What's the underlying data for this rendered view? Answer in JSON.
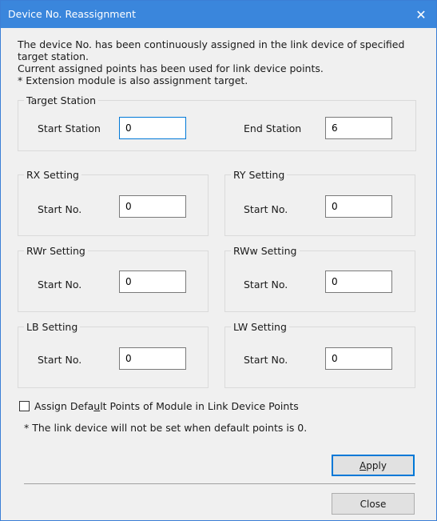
{
  "window": {
    "title": "Device No. Reassignment",
    "close_glyph": "✕"
  },
  "description": {
    "line1": "The device No. has been continuously assigned in the link device of specified",
    "line2": "target station.",
    "line3": "Current assigned points has been used for link device points.",
    "line4": "* Extension module is also assignment target."
  },
  "target_station": {
    "legend": "Target Station",
    "start_label": "Start Station",
    "start_value": "0",
    "end_label": "End Station",
    "end_value": "6"
  },
  "rx": {
    "legend": "RX Setting",
    "start_label": "Start No.",
    "start_value": "0"
  },
  "ry": {
    "legend": "RY Setting",
    "start_label": "Start No.",
    "start_value": "0"
  },
  "rwr": {
    "legend": "RWr Setting",
    "start_label": "Start No.",
    "start_value": "0"
  },
  "rww": {
    "legend": "RWw Setting",
    "start_label": "Start No.",
    "start_value": "0"
  },
  "lb": {
    "legend": "LB Setting",
    "start_label": "Start No.",
    "start_value": "0"
  },
  "lw": {
    "legend": "LW Setting",
    "start_label": "Start No.",
    "start_value": "0"
  },
  "options": {
    "assign_default_label_pre": "Assign Defa",
    "assign_default_label_mnemonic": "u",
    "assign_default_label_post": "lt Points of Module in Link Device Points",
    "assign_default_checked": false,
    "note": "* The link device will not be set when default points is 0."
  },
  "buttons": {
    "apply_mnemonic": "A",
    "apply_rest": "pply",
    "close": "Close"
  },
  "colors": {
    "title_bar": "#3a86dc",
    "focus_border": "#0078d7"
  }
}
